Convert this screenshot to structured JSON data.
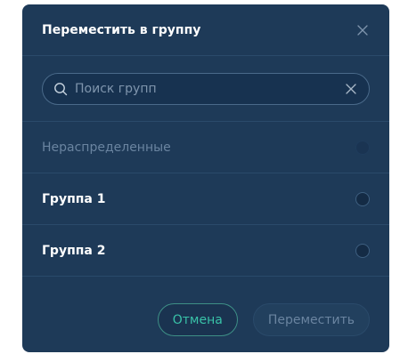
{
  "modal": {
    "title": "Переместить в группу"
  },
  "search": {
    "placeholder": "Поиск групп",
    "value": ""
  },
  "groups": [
    {
      "label": "Нераспределенные",
      "disabled": true
    },
    {
      "label": "Группа 1",
      "disabled": false
    },
    {
      "label": "Группа 2",
      "disabled": false
    }
  ],
  "footer": {
    "cancel_label": "Отмена",
    "move_label": "Переместить"
  },
  "colors": {
    "modal_bg": "#1e3a58",
    "accent": "#39c2a8",
    "divider": "#2a4a6a"
  },
  "icons": {
    "close": "close-icon",
    "search": "search-icon",
    "clear": "clear-icon"
  }
}
